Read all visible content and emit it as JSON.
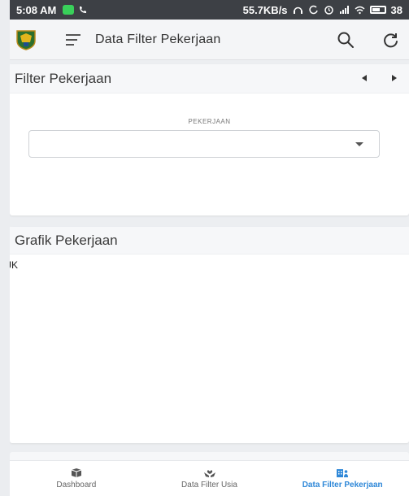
{
  "status_bar": {
    "time": "5:08 AM",
    "network_speed": "55.7KB/s",
    "battery": "38"
  },
  "app_bar": {
    "title": "Data Filter Pekerjaan",
    "icons": [
      "logo-icon",
      "menu-icon",
      "search-icon",
      "refresh-icon"
    ]
  },
  "filter_card": {
    "title": "Filter Pekerjaan",
    "field_label": "PEKERJAAN",
    "select_value": ""
  },
  "chart_card": {
    "title": "Grafik Pekerjaan",
    "label": "JK"
  },
  "bottom_nav": {
    "items": [
      {
        "label": "Dashboard",
        "icon": "dashboard-icon",
        "active": false
      },
      {
        "label": "Data Filter Usia",
        "icon": "hands-heart-icon",
        "active": false
      },
      {
        "label": "Data Filter Pekerjaan",
        "icon": "building-people-icon",
        "active": true
      }
    ]
  },
  "colors": {
    "accent": "#2f88d8",
    "status_bar": "#3d4045",
    "whatsapp": "#39d05a"
  }
}
